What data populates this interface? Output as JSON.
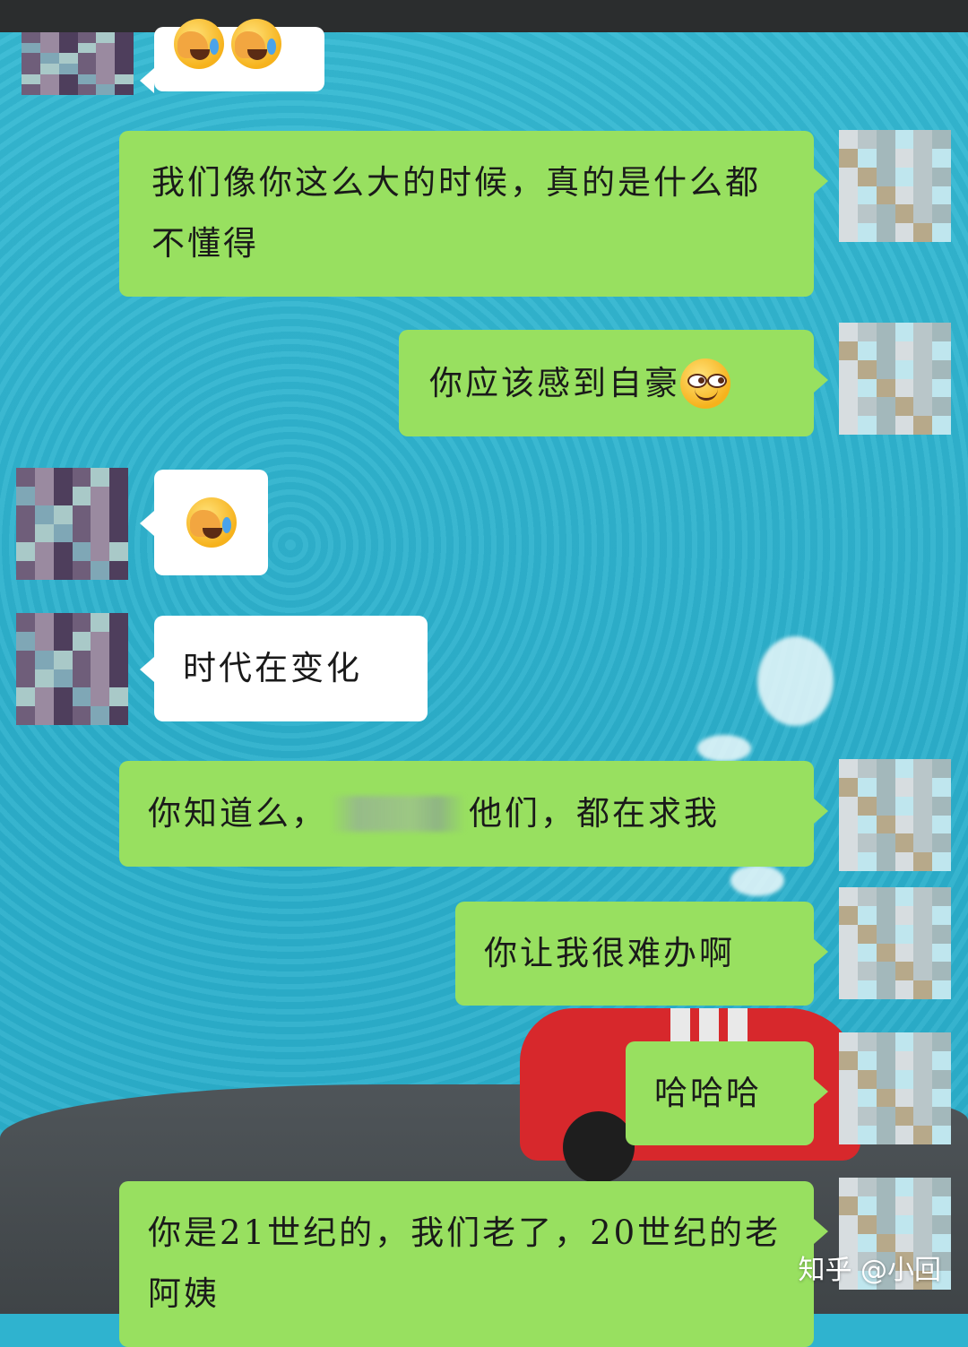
{
  "chat": {
    "messages": [
      {
        "side": "left",
        "kind": "emoji",
        "emojis": [
          "face-palm-crying",
          "face-palm-crying"
        ]
      },
      {
        "side": "right",
        "kind": "text",
        "text": "我们像你这么大的时候，真的是什么都不懂得"
      },
      {
        "side": "right",
        "kind": "text",
        "text": "你应该感到自豪",
        "emoji": "smirking-face"
      },
      {
        "side": "left",
        "kind": "emoji",
        "emojis": [
          "face-palm-crying"
        ]
      },
      {
        "side": "left",
        "kind": "text",
        "text": "时代在变化"
      },
      {
        "side": "right",
        "kind": "text",
        "text_before": "你知道么，",
        "text_after": "他们，都在求我",
        "redacted": true
      },
      {
        "side": "right",
        "kind": "text",
        "text": "你让我很难办啊"
      },
      {
        "side": "right",
        "kind": "text",
        "text": "哈哈哈"
      },
      {
        "side": "right",
        "kind": "text",
        "text": "你是21世纪的，我们老了，20世纪的老阿姨"
      }
    ]
  },
  "watermark": "知乎 @小回",
  "colors": {
    "bubble_self": "#98e060",
    "bubble_other": "#ffffff",
    "background": "#2fb3cf"
  }
}
